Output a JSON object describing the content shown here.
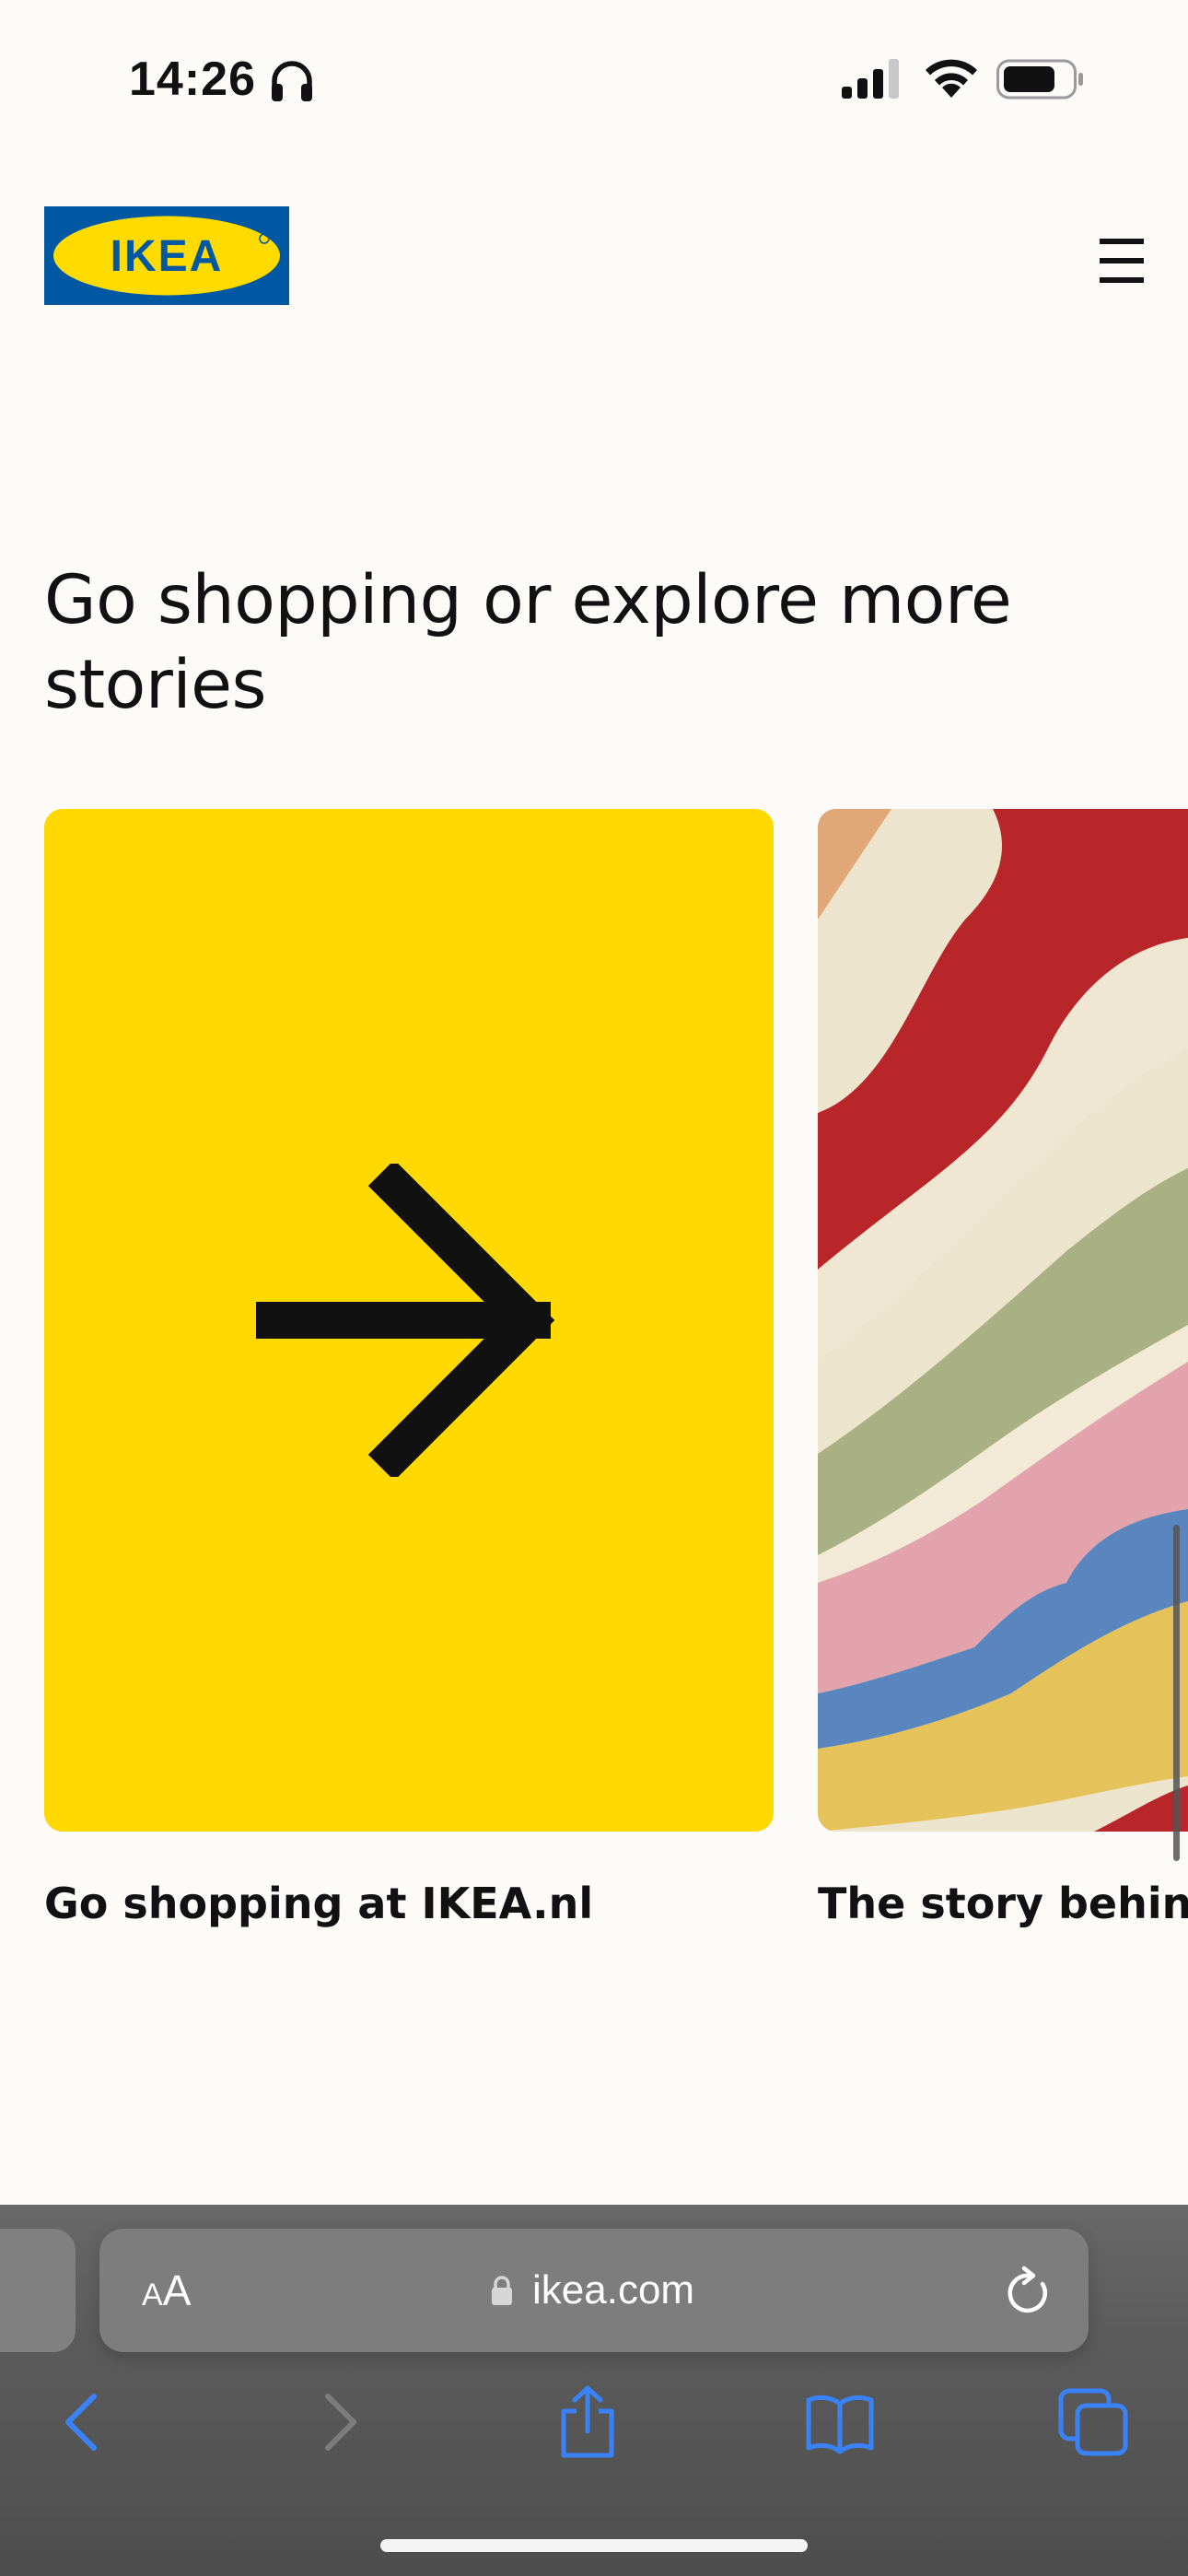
{
  "status_bar": {
    "time": "14:26",
    "icons": [
      "headphones-icon",
      "signal-icon",
      "wifi-icon",
      "battery-icon"
    ]
  },
  "header": {
    "logo_text": "IKEA",
    "logo_colors": {
      "blue": "#0058a3",
      "yellow": "#ffdb00"
    },
    "menu_icon": "hamburger-menu-icon"
  },
  "section": {
    "title": "Go shopping or explore more stories"
  },
  "cards": [
    {
      "caption": "Go shopping at IKEA.nl",
      "icon": "arrow-right-icon",
      "background": "#ffd900"
    },
    {
      "caption": "The story behind",
      "image": "striped-textile-image"
    }
  ],
  "safari": {
    "reader_label_small": "A",
    "reader_label_large": "A",
    "url": "ikea.com",
    "accent_color": "#3a82f7",
    "icons": [
      "lock-icon",
      "reload-icon",
      "back-icon",
      "forward-icon",
      "share-icon",
      "bookmarks-icon",
      "tabs-icon"
    ]
  }
}
